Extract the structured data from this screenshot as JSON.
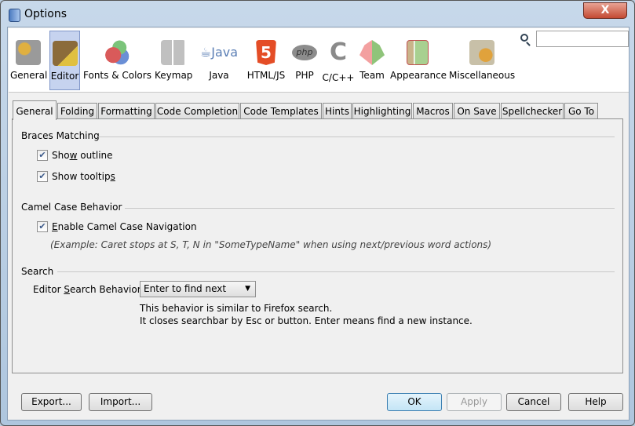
{
  "window": {
    "title": "Options",
    "close_label": "X"
  },
  "categories": [
    {
      "label": "General",
      "icon": "gear-wrench-icon",
      "color": "#8a8a8a"
    },
    {
      "label": "Editor",
      "icon": "pencil-book-icon",
      "color": "#8b6b3a",
      "selected": true
    },
    {
      "label": "Fonts & Colors",
      "icon": "font-color-icon",
      "color": "#d95a5a"
    },
    {
      "label": "Keymap",
      "icon": "keyboard-icon",
      "color": "#b0b0b0"
    },
    {
      "label": "Java",
      "icon": "java-icon",
      "color": "#5b7fb5"
    },
    {
      "label": "HTML/JS",
      "icon": "html5-icon",
      "color": "#e44d26"
    },
    {
      "label": "PHP",
      "icon": "php-icon",
      "color": "#8c8c8c"
    },
    {
      "label": "C/C++",
      "icon": "cpp-icon",
      "color": "#9a9a9a"
    },
    {
      "label": "Team",
      "icon": "cubes-icon",
      "color": "#8fc47a"
    },
    {
      "label": "Appearance",
      "icon": "layout-icon",
      "color": "#c9b48a"
    },
    {
      "label": "Miscellaneous",
      "icon": "folder-gear-icon",
      "color": "#e0a23c"
    }
  ],
  "search": {
    "value": "",
    "placeholder": ""
  },
  "tabs": [
    "General",
    "Folding",
    "Formatting",
    "Code Completion",
    "Code Templates",
    "Hints",
    "Highlighting",
    "Macros",
    "On Save",
    "Spellchecker",
    "Go To"
  ],
  "selected_tab": "General",
  "braces": {
    "heading": "Braces Matching",
    "show_outline": {
      "pre": "Sho",
      "u": "w",
      "post": " outline",
      "checked": true
    },
    "show_tooltips": {
      "pre": "Show tooltip",
      "u": "s",
      "post": "",
      "checked": true
    }
  },
  "camel": {
    "heading": "Camel Case  Behavior",
    "enable": {
      "pre": "",
      "u": "E",
      "post": "nable Camel Case Navigation",
      "checked": true
    },
    "example": "(Example: Caret stops at S, T, N in \"SomeTypeName\" when using next/previous word actions)"
  },
  "search_section": {
    "heading": "Search",
    "label_pre": "Editor ",
    "label_u": "S",
    "label_post": "earch Behavior",
    "selected": "Enter to find next",
    "desc1": "This behavior is similar to Firefox search.",
    "desc2": "It closes searchbar by Esc or button. Enter means find a new instance."
  },
  "buttons": {
    "export": "Export...",
    "import": "Import...",
    "ok": "OK",
    "apply": "Apply",
    "cancel": "Cancel",
    "help": "Help"
  }
}
